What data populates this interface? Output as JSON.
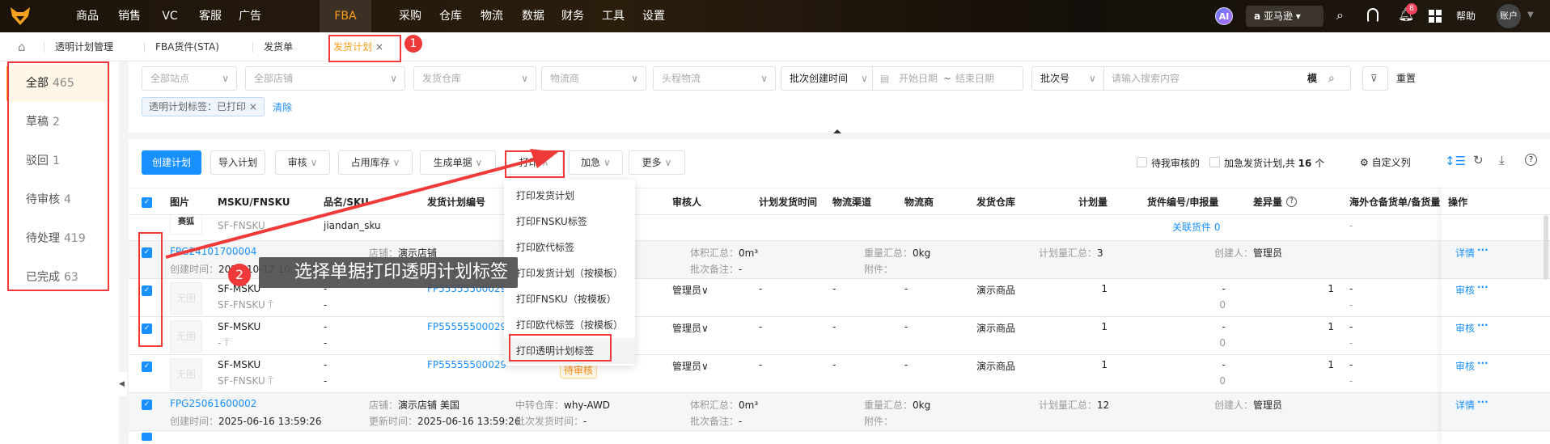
{
  "nav": {
    "items": [
      "商品",
      "销售",
      "VC",
      "客服",
      "广告",
      "FBA",
      "采购",
      "仓库",
      "物流",
      "数据",
      "财务",
      "工具",
      "设置"
    ],
    "active": "FBA",
    "ai": "AI",
    "store": "亚马逊",
    "notifications": "8",
    "help": "帮助",
    "account": "账户"
  },
  "tabs": [
    {
      "label": "透明计划管理"
    },
    {
      "label": "FBA货件(STA)"
    },
    {
      "label": "发货单"
    },
    {
      "label": "发货计划",
      "close": "×"
    }
  ],
  "sidebar": [
    {
      "label": "全部",
      "count": "465"
    },
    {
      "label": "草稿",
      "count": "2"
    },
    {
      "label": "驳回",
      "count": "1"
    },
    {
      "label": "待审核",
      "count": "4"
    },
    {
      "label": "待处理",
      "count": "419"
    },
    {
      "label": "已完成",
      "count": "63"
    }
  ],
  "filters": {
    "site": "全部站点",
    "shop": "全部店铺",
    "warehouse": "发货仓库",
    "carrier": "物流商",
    "first_leg": "头程物流",
    "time_type": "批次创建时间",
    "start_date": "开始日期",
    "tilde": "~",
    "end_date": "结束日期",
    "search_type": "批次号",
    "search_placeholder": "请输入搜索内容",
    "fuzzy": "模",
    "reset": "重置",
    "tag": "透明计划标签：已打印",
    "tag_close": "×",
    "clear": "清除"
  },
  "toolbar": {
    "create": "创建计划",
    "import": "导入计划",
    "review": "审核",
    "stock": "占用库存",
    "generate": "生成单据",
    "print": "打印",
    "urgent": "加急",
    "more": "更多",
    "pending_mine": "待我审核的",
    "urgent_plan": "加急发货计划,共",
    "total": "16",
    "unit": "个",
    "custom_cols": "自定义列"
  },
  "print_menu": [
    "打印发货计划",
    "打印FNSKU标签",
    "打印欧代标签",
    "打印发货计划（按模板）",
    "打印FNSKU（按模板）",
    "打印欧代标签（按模板）",
    "打印透明计划标签"
  ],
  "columns": [
    "图片",
    "MSKU/FNSKU",
    "品名/SKU",
    "发货计划编号",
    "审核人",
    "计划发货时间",
    "物流渠道",
    "物流商",
    "发货仓库",
    "计划量",
    "货件编号/申报量",
    "差异量",
    "海外仓备货单/备货量",
    "操作"
  ],
  "partial_row": {
    "image": "赛狐",
    "fnsku": "SF-FNSKU",
    "sku": "jiandan_sku",
    "shipment_link": "关联货件 0",
    "overseas": "-"
  },
  "groups": [
    {
      "id": "FPG24101700004",
      "created_label": "创建时间：",
      "created": "2024-10-17 10:29:26",
      "shop_label": "店铺：",
      "shop": "演示店铺",
      "updated_label": "更新时间：",
      "updated": "2025-06-16 17:22:52",
      "volume_label": "体积汇总：",
      "volume": "0m³",
      "remark_label": "批次备注：",
      "remark": "-",
      "weight_label": "重量汇总：",
      "weight": "0kg",
      "attach_label": "附件：",
      "qty_label": "计划量汇总：",
      "qty": "3",
      "creator_label": "创建人：",
      "creator": "管理员",
      "action": "详情",
      "more": "···",
      "items": [
        {
          "no_image": "无图",
          "msku": "SF-MSKU",
          "fnsku": "SF-FNSKU",
          "name": "-",
          "sku": "-",
          "plan_no": "FP55555500029",
          "status": "待审核",
          "reviewer": "管理员",
          "ship_time": "-",
          "channel": "-",
          "carrier": "-",
          "warehouse": "演示商品",
          "plan_qty": "1",
          "shipment": "-",
          "declared": "0",
          "diff": "1",
          "overseas": "-",
          "overseas_qty": "-",
          "action": "审核",
          "more": "···"
        },
        {
          "no_image": "无图",
          "msku": "SF-MSKU",
          "fnsku": "-",
          "name": "-",
          "sku": "-",
          "plan_no": "FP55555500029",
          "status": "待审核",
          "reviewer": "管理员",
          "ship_time": "-",
          "channel": "-",
          "carrier": "-",
          "warehouse": "演示商品",
          "plan_qty": "1",
          "shipment": "-",
          "declared": "0",
          "diff": "1",
          "overseas": "-",
          "overseas_qty": "-",
          "action": "审核",
          "more": "···"
        },
        {
          "no_image": "无图",
          "msku": "SF-MSKU",
          "fnsku": "SF-FNSKU",
          "name": "-",
          "sku": "-",
          "plan_no": "FP55555500029",
          "status": "待审核",
          "reviewer": "管理员",
          "ship_time": "-",
          "channel": "-",
          "carrier": "-",
          "warehouse": "演示商品",
          "plan_qty": "1",
          "shipment": "-",
          "declared": "0",
          "diff": "1",
          "overseas": "-",
          "overseas_qty": "-",
          "action": "审核",
          "more": "···"
        }
      ]
    },
    {
      "id": "FPG25061600002",
      "created_label": "创建时间：",
      "created": "2025-06-16 13:59:26",
      "shop_label": "店铺：",
      "shop": "演示店铺 美国",
      "updated_label": "更新时间：",
      "updated": "2025-06-16 13:59:26",
      "transit_label": "中转仓库：",
      "transit": "why-AWD",
      "batch_ship_label": "批次发货时间：",
      "batch_ship": "-",
      "volume_label": "体积汇总：",
      "volume": "0m³",
      "remark_label": "批次备注：",
      "remark": "-",
      "weight_label": "重量汇总：",
      "weight": "0kg",
      "attach_label": "附件：",
      "qty_label": "计划量汇总：",
      "qty": "12",
      "creator_label": "创建人：",
      "creator": "管理员",
      "action": "详情",
      "more": "···",
      "items": []
    }
  ],
  "annotations": {
    "step1": "1",
    "step2": "2",
    "tip": "选择单据打印透明计划标签"
  },
  "colors": {
    "accent": "#ff9d1a",
    "primary": "#1890ff",
    "annotation": "#f03a3a"
  }
}
